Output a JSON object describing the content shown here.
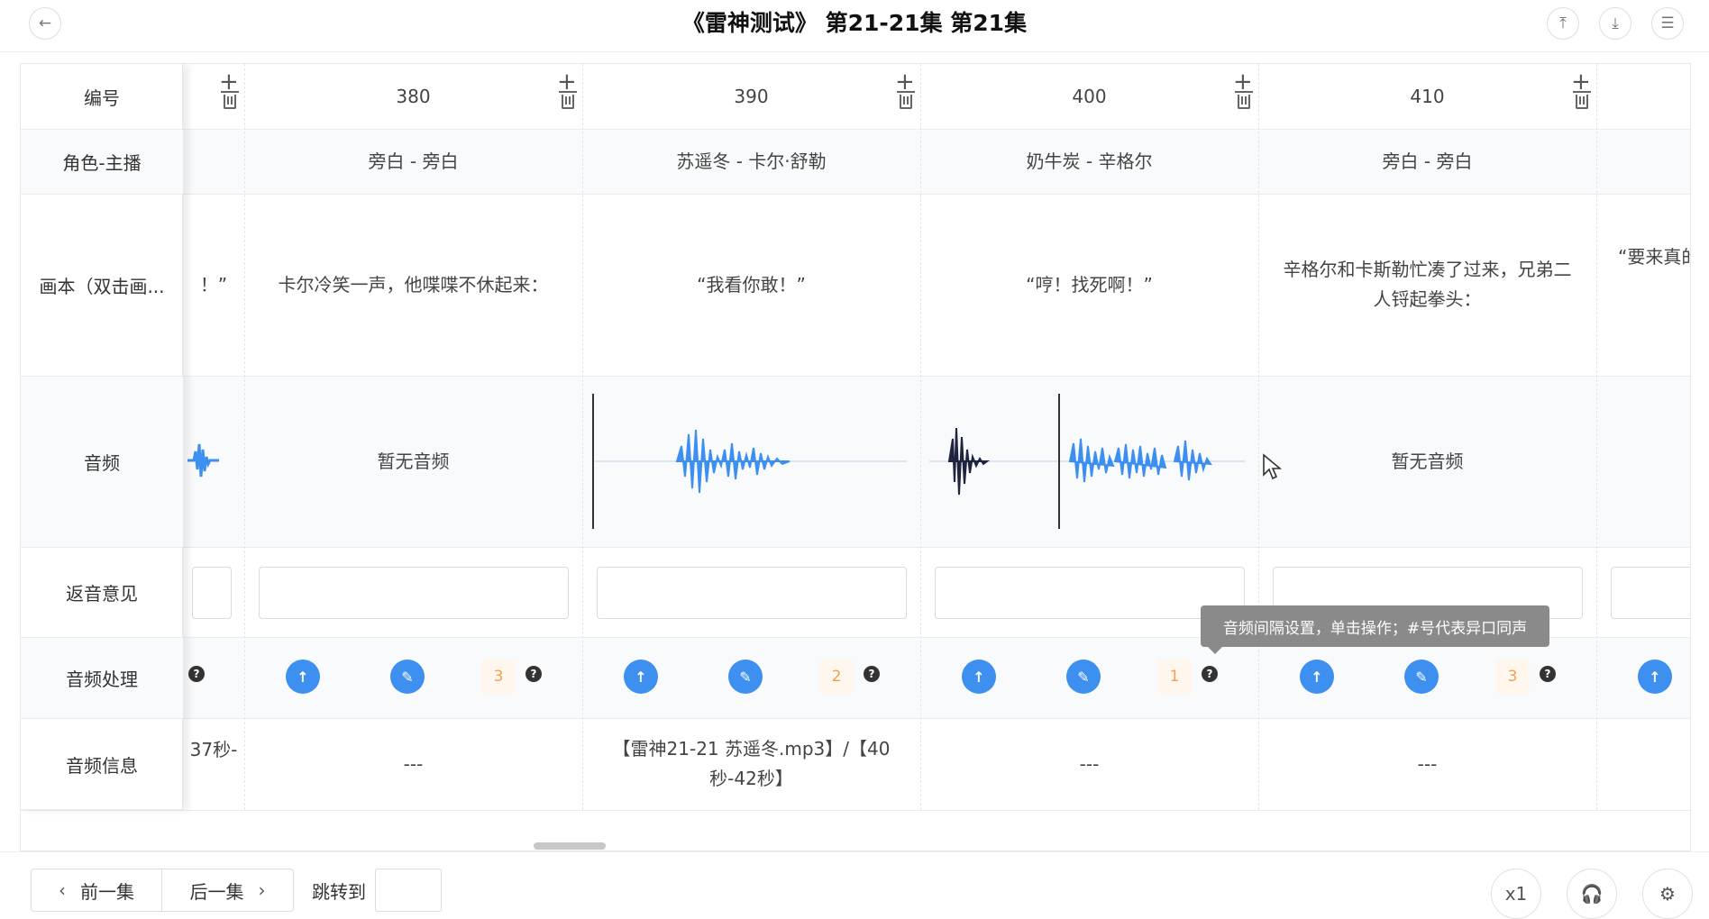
{
  "header": {
    "title": "《雷神测试》 第21-21集 第21集"
  },
  "labels": {
    "id": "编号",
    "role": "角色-主播",
    "script": "画本（双击画...",
    "audio": "音频",
    "feedback": "返音意见",
    "processing": "音频处理",
    "info": "音频信息"
  },
  "columns": [
    {
      "id": "380",
      "role": "旁白 - 旁白",
      "script": "卡尔冷笑一声，他喋喋不休起来：",
      "audio": "暂无音频",
      "count": "3",
      "info": "---"
    },
    {
      "id": "390",
      "role": "苏遥冬 - 卡尔·舒勒",
      "script": "“我看你敢！”",
      "audio": "",
      "count": "2",
      "info": "【雷神21-21 苏遥冬.mp3】/【40秒-42秒】"
    },
    {
      "id": "400",
      "role": "奶牛炭 - 辛格尔",
      "script": "“哼！找死啊！”",
      "audio": "",
      "count": "1",
      "info": "---"
    },
    {
      "id": "410",
      "role": "旁白 - 旁白",
      "script": "辛格尔和卡斯勒忙凑了过来，兄弟二人锊起拳头：",
      "audio": "暂无音频",
      "count": "3",
      "info": "---"
    }
  ],
  "partial": {
    "left_script": "！”",
    "left_info": "37秒-",
    "right_script": "“要来真的"
  },
  "tooltip": "音频间隔设置，单击操作；#号代表异口同声",
  "footer": {
    "prev": "前一集",
    "next": "后一集",
    "jump": "跳转到",
    "speed": "x1"
  },
  "colors": {
    "accent": "#3d8ff0",
    "wave": "#3d8ff0",
    "wave_dark": "#1f2440"
  }
}
